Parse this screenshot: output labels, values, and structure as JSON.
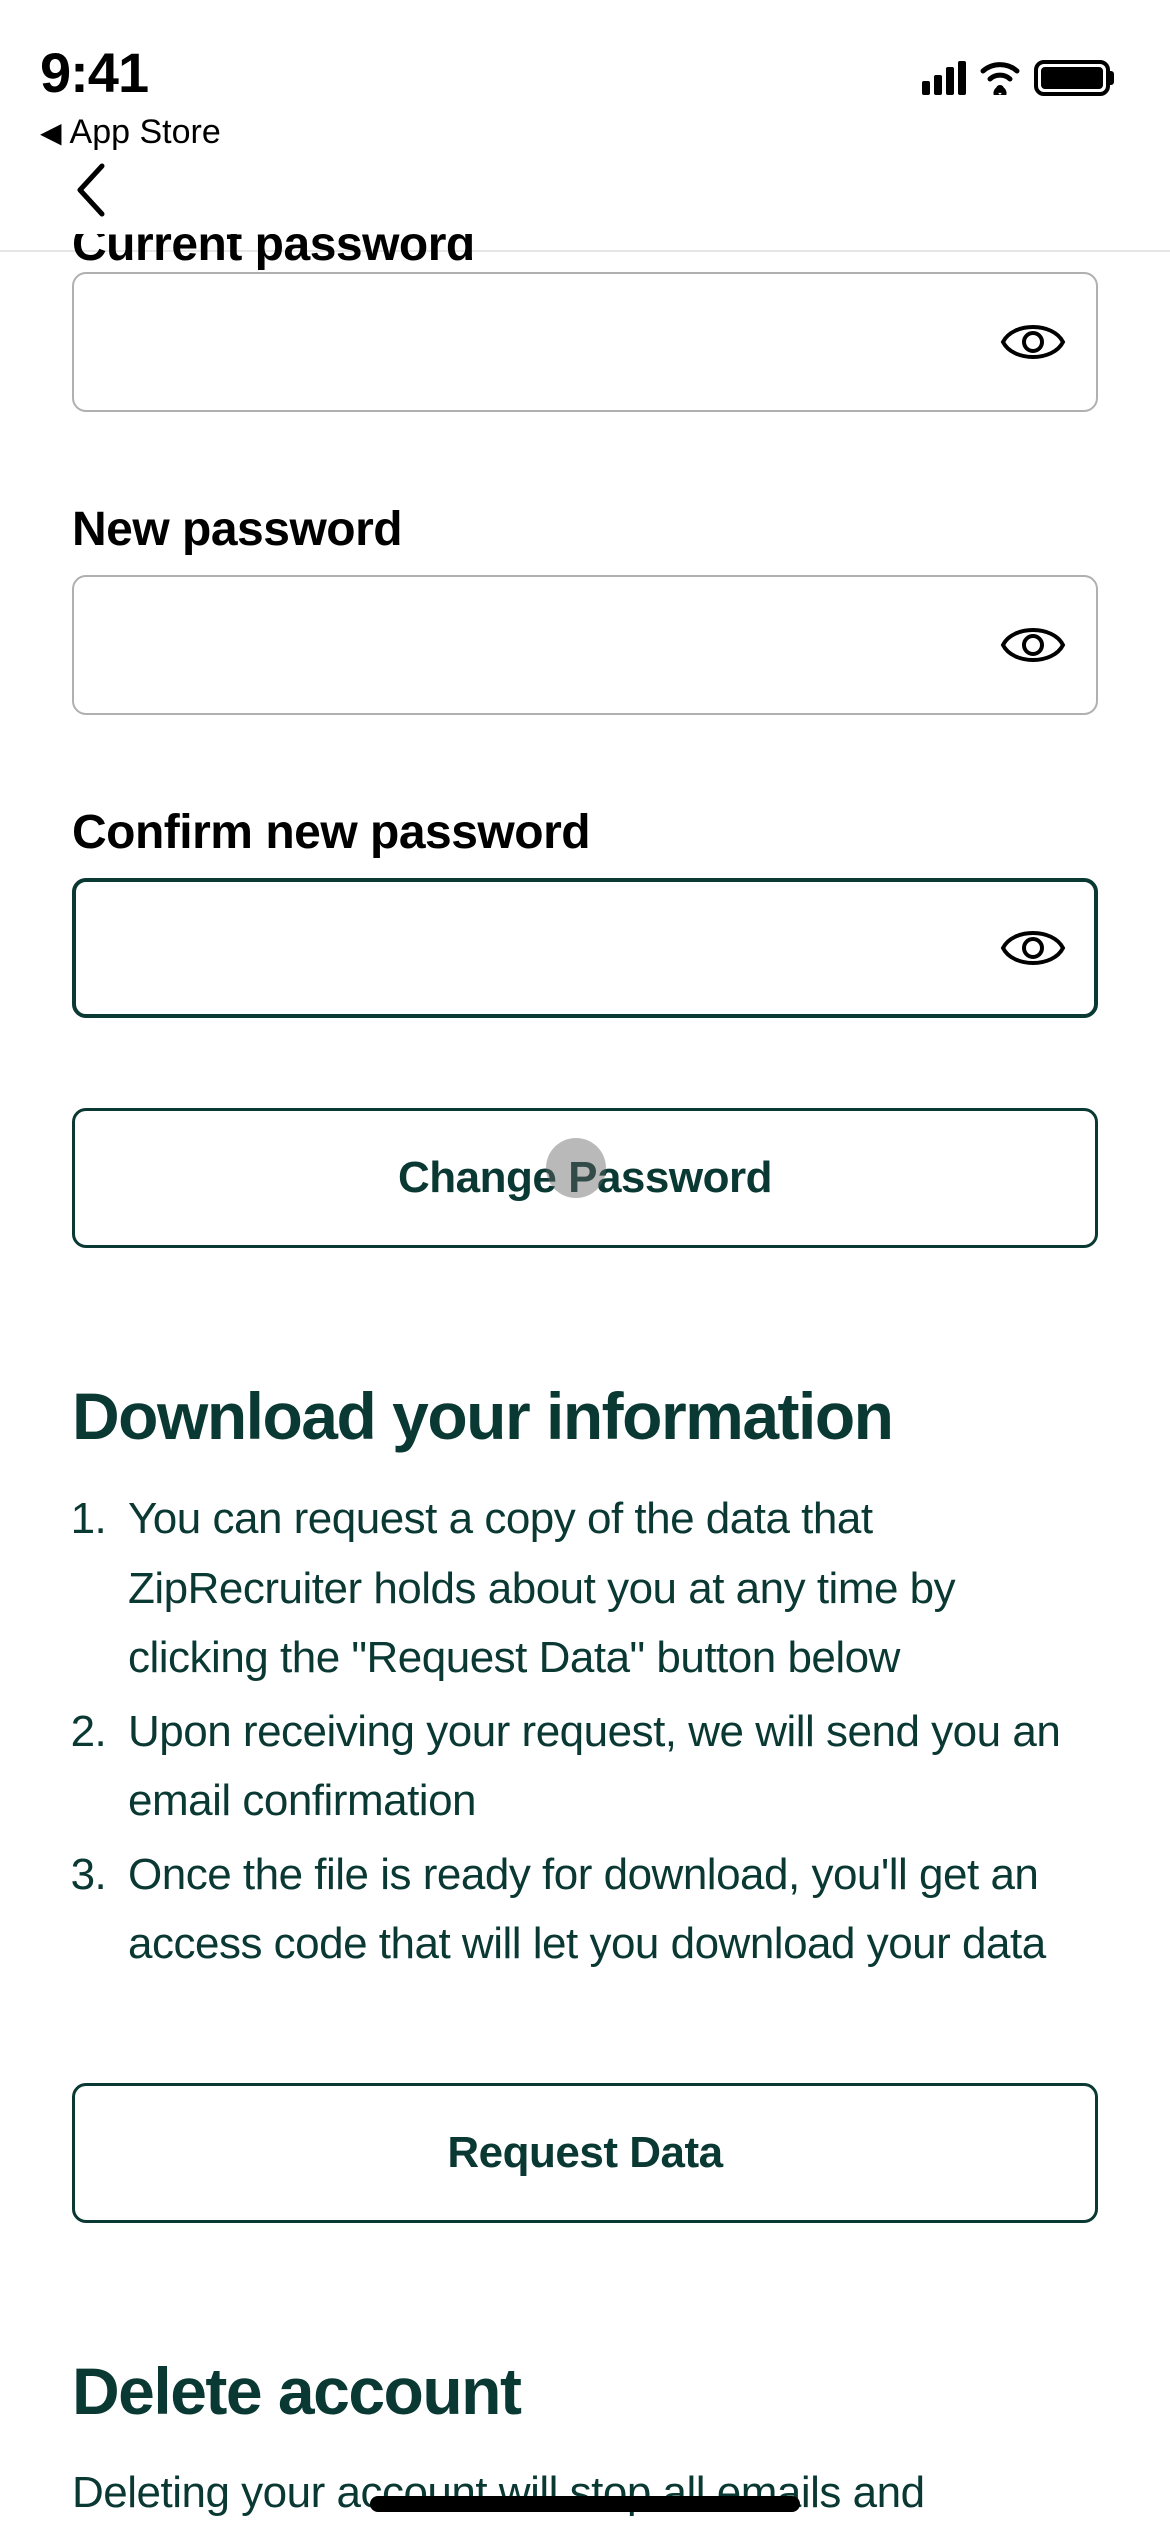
{
  "status_bar": {
    "time": "9:41",
    "return_app": "App Store"
  },
  "password_section": {
    "current_label": "Current password",
    "new_label": "New password",
    "confirm_label": "Confirm new password",
    "change_button": "Change Password"
  },
  "download_section": {
    "heading": "Download your information",
    "items": [
      "You can request a copy of the data that ZipRecruiter holds about you at any time by clicking the \"Request Data\" button below",
      "Upon receiving your request, we will send you an email confirmation",
      "Once the file is ready for download, you'll get an access code that will let you download your data"
    ],
    "request_button": "Request Data"
  },
  "delete_section": {
    "heading": "Delete account",
    "body": "Deleting your account will stop all emails and"
  }
}
